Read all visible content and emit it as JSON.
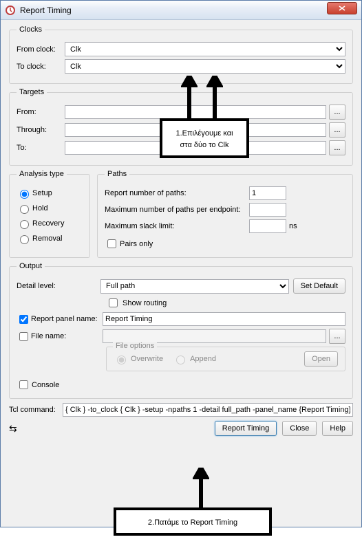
{
  "window": {
    "title": "Report Timing"
  },
  "clocks": {
    "legend": "Clocks",
    "from_label": "From clock:",
    "from_value": "Clk",
    "to_label": "To clock:",
    "to_value": "Clk"
  },
  "targets": {
    "legend": "Targets",
    "from_label": "From:",
    "through_label": "Through:",
    "to_label": "To:",
    "from_value": "",
    "through_value": "",
    "to_value": "",
    "browse": "..."
  },
  "analysis": {
    "legend": "Analysis type",
    "options": [
      "Setup",
      "Hold",
      "Recovery",
      "Removal"
    ],
    "selected": "Setup"
  },
  "paths": {
    "legend": "Paths",
    "num_label": "Report number of paths:",
    "num_value": "1",
    "max_ep_label": "Maximum number of paths per endpoint:",
    "max_ep_value": "",
    "slack_label": "Maximum slack limit:",
    "slack_value": "",
    "slack_unit": "ns",
    "pairs_label": "Pairs only",
    "pairs_checked": false
  },
  "output": {
    "legend": "Output",
    "detail_label": "Detail level:",
    "detail_value": "Full path",
    "set_default": "Set Default",
    "show_routing_label": "Show routing",
    "show_routing_checked": false,
    "panel_checked": true,
    "panel_label": "Report panel name:",
    "panel_value": "Report Timing",
    "file_checked": false,
    "file_label": "File name:",
    "file_value": "",
    "file_browse": "...",
    "file_options_legend": "File options",
    "file_overwrite": "Overwrite",
    "file_append": "Append",
    "file_open": "Open",
    "console_label": "Console",
    "console_checked": false
  },
  "tcl": {
    "label": "Tcl command:",
    "value": "{ Clk } -to_clock { Clk } -setup -npaths 1 -detail full_path -panel_name {Report Timing}"
  },
  "buttons": {
    "report": "Report Timing",
    "close": "Close",
    "help": "Help"
  },
  "annotations": {
    "a1": "1.Επιλέγουμε και στα δύο το Clk",
    "a2": "2.Πατάμε το Report Timing"
  }
}
